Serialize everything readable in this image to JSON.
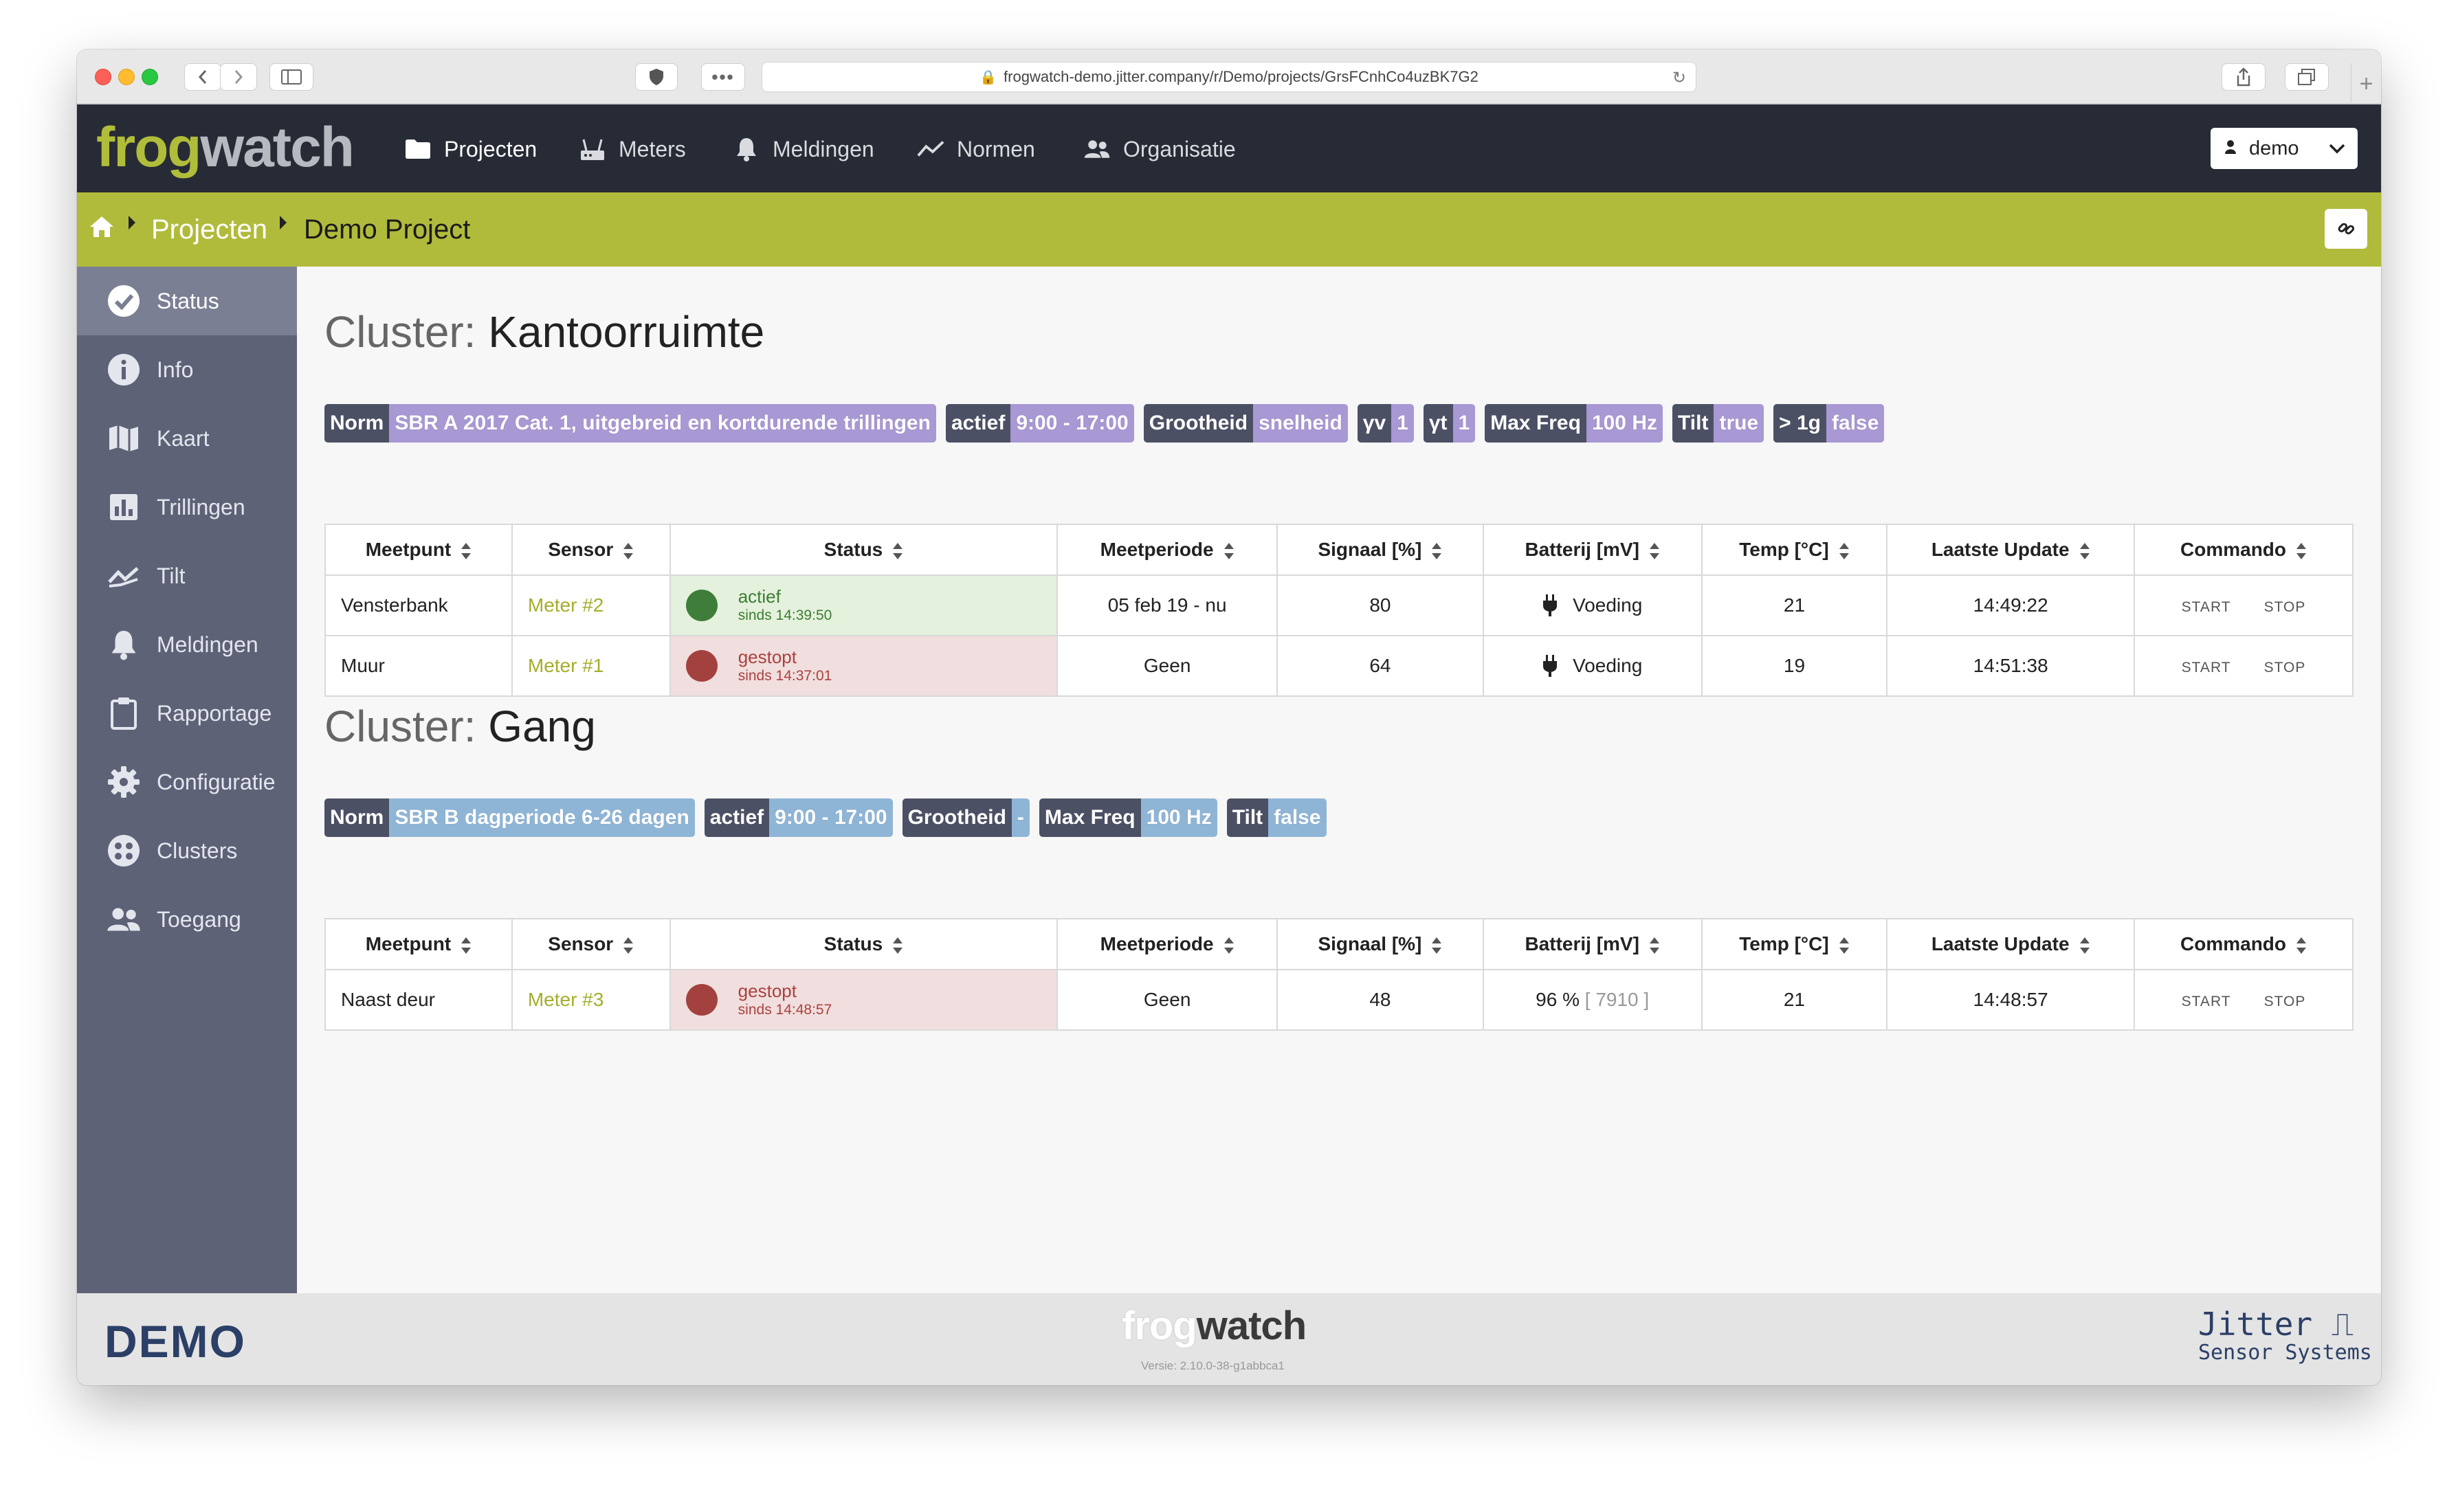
{
  "browser": {
    "url": "frogwatch-demo.jitter.company/r/Demo/projects/GrsFCnhCo4uzBK7G2"
  },
  "brand": {
    "logo_part1": "frog",
    "logo_part2": "watch"
  },
  "nav": {
    "items": [
      {
        "label": "Projecten",
        "icon": "folder-icon"
      },
      {
        "label": "Meters",
        "icon": "router-icon"
      },
      {
        "label": "Meldingen",
        "icon": "bell-icon"
      },
      {
        "label": "Normen",
        "icon": "chart-line-icon"
      },
      {
        "label": "Organisatie",
        "icon": "users-icon"
      }
    ],
    "user": "demo"
  },
  "breadcrumb": {
    "home_icon": "home-icon",
    "projects": "Projecten",
    "current": "Demo Project"
  },
  "sidebar": {
    "items": [
      {
        "label": "Status",
        "icon": "check-circle-icon"
      },
      {
        "label": "Info",
        "icon": "info-icon"
      },
      {
        "label": "Kaart",
        "icon": "map-icon"
      },
      {
        "label": "Trillingen",
        "icon": "bar-chart-icon"
      },
      {
        "label": "Tilt",
        "icon": "tilt-icon"
      },
      {
        "label": "Meldingen",
        "icon": "bell-icon"
      },
      {
        "label": "Rapportage",
        "icon": "clipboard-icon"
      },
      {
        "label": "Configuratie",
        "icon": "gear-icon"
      },
      {
        "label": "Clusters",
        "icon": "clusters-icon"
      },
      {
        "label": "Toegang",
        "icon": "users-icon"
      }
    ]
  },
  "table_headers": [
    "Meetpunt",
    "Sensor",
    "Status",
    "Meetperiode",
    "Signaal [%]",
    "Batterij [mV]",
    "Temp [°C]",
    "Laatste Update",
    "Commando"
  ],
  "commands": {
    "start": "START",
    "stop": "STOP"
  },
  "clusters": [
    {
      "prefix": "Cluster:",
      "name": "Kantoorruimte",
      "tags": [
        {
          "k": "Norm",
          "v": "SBR A 2017 Cat. 1, uitgebreid en kortdurende trillingen"
        },
        {
          "k": "actief",
          "v": "9:00 - 17:00"
        },
        {
          "k": "Grootheid",
          "v": "snelheid"
        },
        {
          "k": "γv",
          "v": "1"
        },
        {
          "k": "γt",
          "v": "1"
        },
        {
          "k": "Max Freq",
          "v": "100 Hz"
        },
        {
          "k": "Tilt",
          "v": "true"
        },
        {
          "k": "> 1g",
          "v": "false"
        }
      ],
      "rows": [
        {
          "meetpunt": "Vensterbank",
          "sensor": "Meter #2",
          "status": "actief",
          "since": "sinds 14:39:50",
          "periode": "05 feb 19 - nu",
          "signaal": "80",
          "batterij": "Voeding",
          "temp": "21",
          "update": "14:49:22"
        },
        {
          "meetpunt": "Muur",
          "sensor": "Meter #1",
          "status": "gestopt",
          "since": "sinds 14:37:01",
          "periode": "Geen",
          "signaal": "64",
          "batterij": "Voeding",
          "temp": "19",
          "update": "14:51:38"
        }
      ]
    },
    {
      "prefix": "Cluster:",
      "name": "Gang",
      "tags": [
        {
          "k": "Norm",
          "v": "SBR B dagperiode 6-26 dagen"
        },
        {
          "k": "actief",
          "v": "9:00 - 17:00"
        },
        {
          "k": "Grootheid",
          "v": "-"
        },
        {
          "k": "Max Freq",
          "v": "100 Hz"
        },
        {
          "k": "Tilt",
          "v": "false"
        }
      ],
      "rows": [
        {
          "meetpunt": "Naast deur",
          "sensor": "Meter #3",
          "status": "gestopt",
          "since": "sinds 14:48:57",
          "periode": "Geen",
          "signaal": "48",
          "batterij_pct": "96 %",
          "batterij_mv": "[ 7910 ]",
          "temp": "21",
          "update": "14:48:57"
        }
      ]
    }
  ],
  "footer": {
    "demo": "DEMO",
    "logo_part1": "frog",
    "logo_part2": "watch",
    "version": "Versie: 2.10.0-38-g1abbca1",
    "jitter_line1": "Jitter ⎍",
    "jitter_line2": "Sensor Systems"
  },
  "colors": {
    "accent": "#b0bb3c",
    "navbar": "#272b35",
    "sidebar": "#5e6277",
    "ok": "#3f7d3a",
    "bad": "#a3413f"
  }
}
